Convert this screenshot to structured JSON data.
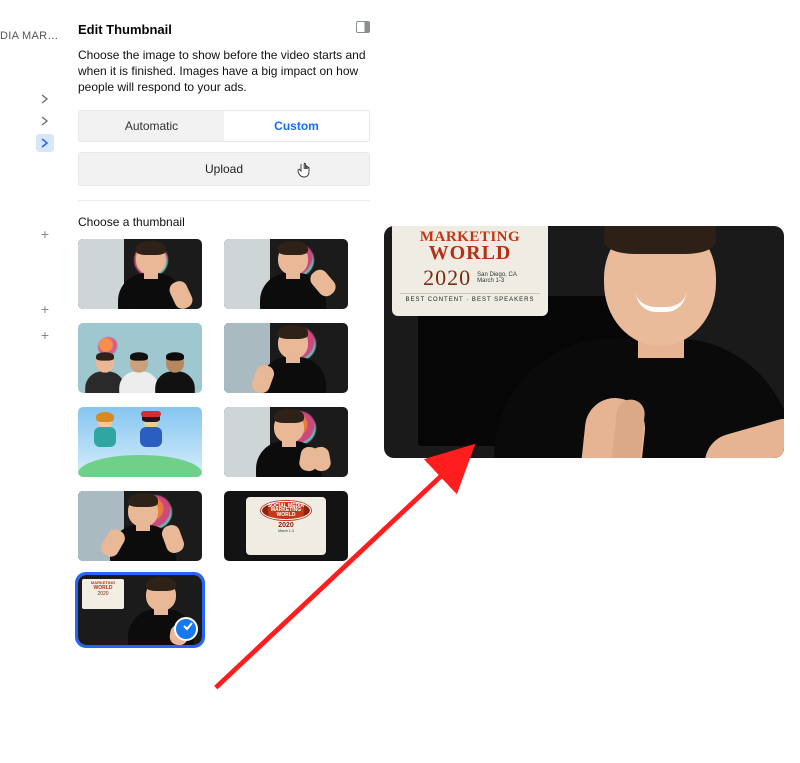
{
  "leftnav": {
    "campaign_label": "DIA MAR…"
  },
  "panel": {
    "title": "Edit Thumbnail",
    "description": "Choose the image to show before the video starts and when it is finished. Images have a big impact on how people will respond to your ads.",
    "tabs": {
      "automatic": "Automatic",
      "custom": "Custom"
    },
    "upload_label": "Upload",
    "choose_label": "Choose a thumbnail"
  },
  "thumbnails": [
    {
      "id": 1,
      "selected": false
    },
    {
      "id": 2,
      "selected": false
    },
    {
      "id": 3,
      "selected": false
    },
    {
      "id": 4,
      "selected": false
    },
    {
      "id": 5,
      "selected": false
    },
    {
      "id": 6,
      "selected": false
    },
    {
      "id": 7,
      "selected": false
    },
    {
      "id": 8,
      "selected": false
    },
    {
      "id": 9,
      "selected": true
    }
  ],
  "event_card": {
    "brand_line1": "MARKETING",
    "brand_line2": "WORLD",
    "year": "2020",
    "location_line1": "San Diego, CA",
    "location_line2": "March 1-3",
    "tagline": "BEST CONTENT · BEST SPEAKERS"
  }
}
